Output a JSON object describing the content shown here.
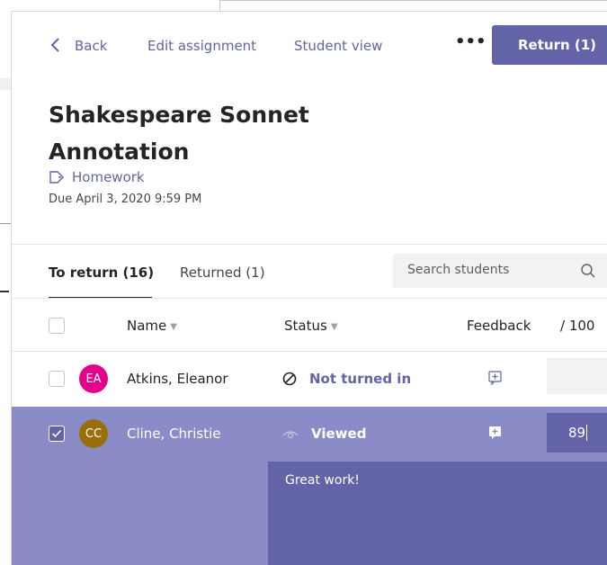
{
  "header": {
    "back_label": "Back",
    "edit_label": "Edit assignment",
    "student_view_label": "Student view",
    "more_label": "•••",
    "return_label": "Return (1)"
  },
  "assignment": {
    "title": "Shakespeare Sonnet Annotation",
    "category": "Homework",
    "due": "Due April 3, 2020 9:59 PM"
  },
  "tabs": [
    {
      "label": "To return (16)",
      "active": true
    },
    {
      "label": "Returned (1)",
      "active": false
    }
  ],
  "search": {
    "placeholder": "Search students"
  },
  "columns": {
    "name": "Name",
    "status": "Status",
    "feedback": "Feedback",
    "points": "/ 100"
  },
  "rows": [
    {
      "initials": "EA",
      "name": "Atkins, Eleanor",
      "status": "Not turned in",
      "avatar_color": "#e3008c",
      "checked": false,
      "points": ""
    },
    {
      "initials": "CC",
      "name": "Cline, Christie",
      "status": "Viewed",
      "avatar_color": "#986f0b",
      "checked": true,
      "points": "89",
      "feedback": "Great work!"
    }
  ],
  "colors": {
    "accent": "#6264a7",
    "selected_row": "#8b8cc7"
  }
}
